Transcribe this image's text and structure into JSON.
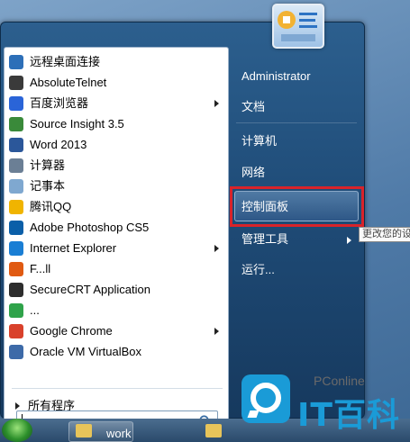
{
  "programs": [
    {
      "label": "远程桌面连接",
      "icon": "remote-desktop-icon",
      "color": "#2d6fb8",
      "submenu": false
    },
    {
      "label": "AbsoluteTelnet",
      "icon": "absolutetelnet-icon",
      "color": "#3a3a3a",
      "submenu": false
    },
    {
      "label": "百度浏览器",
      "icon": "baidu-browser-icon",
      "color": "#2a64d8",
      "submenu": true
    },
    {
      "label": "Source Insight 3.5",
      "icon": "source-insight-icon",
      "color": "#3a8a3a",
      "submenu": false
    },
    {
      "label": "Word 2013",
      "icon": "word-icon",
      "color": "#2b579a",
      "submenu": false
    },
    {
      "label": "计算器",
      "icon": "calculator-icon",
      "color": "#6b7f95",
      "submenu": false
    },
    {
      "label": "记事本",
      "icon": "notepad-icon",
      "color": "#7fa8d0",
      "submenu": false
    },
    {
      "label": "腾讯QQ",
      "icon": "qq-icon",
      "color": "#f0b400",
      "submenu": false
    },
    {
      "label": "Adobe Photoshop CS5",
      "icon": "photoshop-icon",
      "color": "#0b5fa8",
      "submenu": false
    },
    {
      "label": "Internet Explorer",
      "icon": "internet-explorer-icon",
      "color": "#1a7ed4",
      "submenu": true
    },
    {
      "label": "F...ll",
      "icon": "firefox-icon",
      "color": "#e05a12",
      "submenu": false
    },
    {
      "label": "SecureCRT Application",
      "icon": "securecrt-icon",
      "color": "#2d2d2d",
      "submenu": false
    },
    {
      "label": "...",
      "icon": "browser-icon",
      "color": "#2fa34a",
      "submenu": false
    },
    {
      "label": "Google Chrome",
      "icon": "chrome-icon",
      "color": "#d9412b",
      "submenu": true
    },
    {
      "label": "Oracle VM VirtualBox",
      "icon": "virtualbox-icon",
      "color": "#3d6aa8",
      "submenu": false
    }
  ],
  "all_programs_label": "所有程序",
  "search": {
    "placeholder": "",
    "value": ""
  },
  "right_menu": {
    "user_name": "Administrator",
    "items": [
      {
        "label": "文档"
      },
      {
        "label": "计算机"
      },
      {
        "label": "网络"
      },
      {
        "label": "控制面板"
      },
      {
        "label": "管理工具"
      },
      {
        "label": "运行..."
      }
    ]
  },
  "tooltip": "更改您的设",
  "taskbar": {
    "folder_label": "work"
  },
  "watermark": {
    "brand": "PConline",
    "logo_text": "IT百科"
  },
  "colors": {
    "highlight": "#d8232a",
    "menu_bg": "#1f4c78",
    "watermark": "#1a9bd7"
  }
}
